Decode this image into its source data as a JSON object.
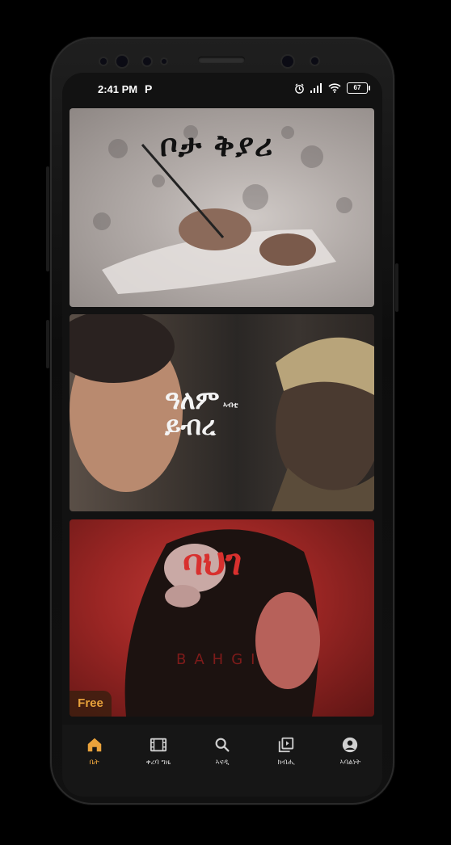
{
  "status_bar": {
    "time": "2:41 PM",
    "notification_icon_text": "P",
    "battery": "67",
    "icons": [
      "alarm-icon",
      "signal-icon",
      "wifi-icon",
      "battery-icon"
    ]
  },
  "cards": [
    {
      "title": "ቦታ ቅያሪ",
      "subtitle": "",
      "badge": ""
    },
    {
      "title": "ዓለም ይብረ",
      "subtitle": "ኣብቲ",
      "badge": ""
    },
    {
      "title": "ባህገ",
      "subtitle": "BAHGI",
      "badge": "Free"
    }
  ],
  "bottom_nav": [
    {
      "label": "ቤት",
      "icon": "home-icon",
      "active": true
    },
    {
      "label": "ቀረባ ግዜ",
      "icon": "film-icon",
      "active": false
    },
    {
      "label": "ኣናዲ",
      "icon": "search-icon",
      "active": false
    },
    {
      "label": "ክብሒ",
      "icon": "library-icon",
      "active": false
    },
    {
      "label": "ኣባልነት",
      "icon": "account-icon",
      "active": false
    }
  ],
  "colors": {
    "accent": "#e9a23b",
    "nav_bg": "#161616",
    "screen_bg": "#121212"
  }
}
